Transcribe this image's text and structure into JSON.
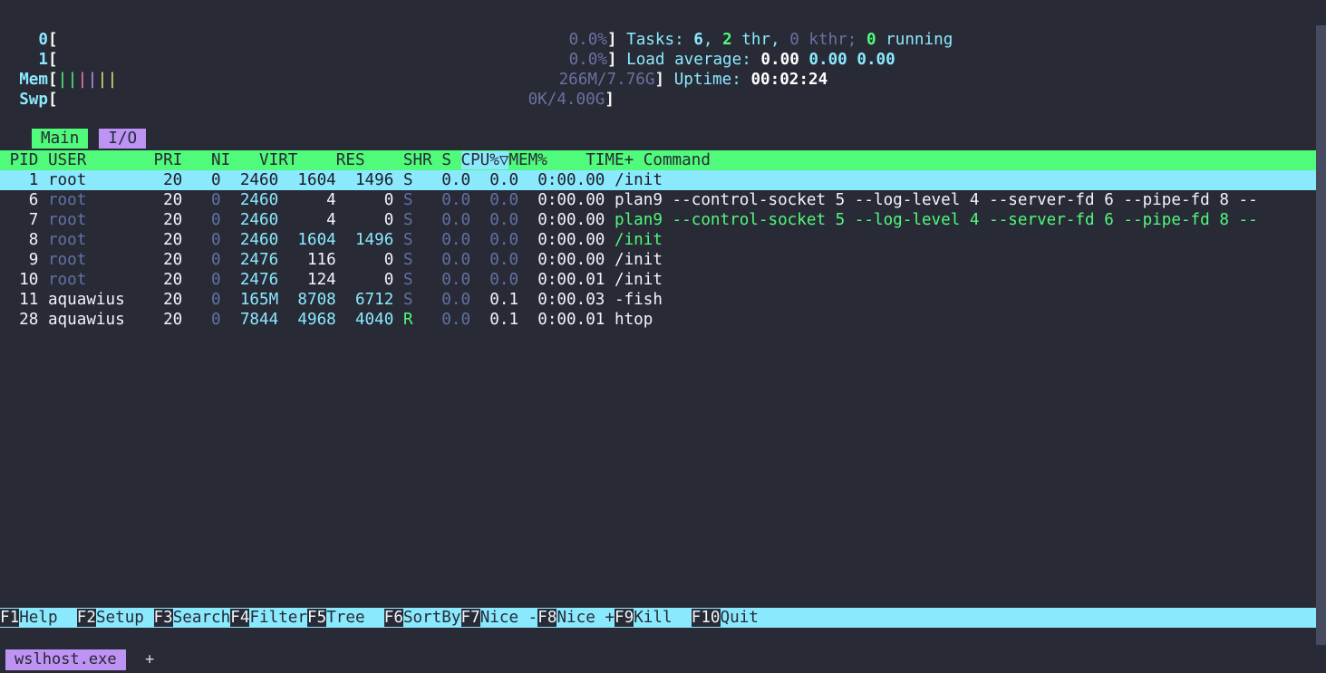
{
  "terminal": {
    "background": "#282a36",
    "foreground": "#f2f4f8"
  },
  "meters": {
    "cpu": [
      {
        "label": "0",
        "bar": "",
        "value": "0.0%"
      },
      {
        "label": "1",
        "bar": "",
        "value": "0.0%"
      }
    ],
    "mem": {
      "label": "Mem",
      "bar_ticks": [
        "|",
        "|",
        "|",
        "|",
        "|",
        "|"
      ],
      "tick_colors": [
        "#50fa7b",
        "#50fa7b",
        "#ff79c6",
        "#bd93f4",
        "#e6e76a",
        "#e6e76a"
      ],
      "value": "266M/7.76G"
    },
    "swp": {
      "label": "Swp",
      "bar_ticks": [],
      "value": "0K/4.00G"
    },
    "bracket_open": "[",
    "bracket_close": "]"
  },
  "summary": {
    "tasks_label": "Tasks:",
    "tasks_count": "6",
    "tasks_comma": ",",
    "threads_count": "2",
    "threads_label": "thr",
    "threads_comma": ",",
    "kthreads": "0 kthr;",
    "running_count": "0",
    "running_label": "running",
    "load_label": "Load average:",
    "load1": "0.00",
    "load5": "0.00",
    "load15": "0.00",
    "uptime_label": "Uptime:",
    "uptime_value": "00:02:24"
  },
  "tabs": [
    {
      "label": "Main",
      "active": true,
      "bg": "#50fa7b"
    },
    {
      "label": "I/O",
      "active": false,
      "bg": "#bd93f4"
    }
  ],
  "table": {
    "columns": [
      "PID",
      "USER",
      "PRI",
      "NI",
      "VIRT",
      "RES",
      "SHR",
      "S",
      "CPU%",
      "MEM%",
      "TIME+",
      "Command"
    ],
    "sort_column": "CPU%",
    "sort_indicator": "▽",
    "header_bg": "#50fa7b",
    "sort_bg": "#8be9fd",
    "rows": [
      {
        "pid": "1",
        "user": "root",
        "pri": "20",
        "ni": "0",
        "virt": "2460",
        "res": "1604",
        "shr": "1496",
        "s": "S",
        "cpu": "0.0",
        "mem": "0.0",
        "time": "0:00.00",
        "command": "/init",
        "selected": true
      },
      {
        "pid": "6",
        "user": "root",
        "pri": "20",
        "ni": "0",
        "virt": "2460",
        "res": "4",
        "shr": "0",
        "s": "S",
        "cpu": "0.0",
        "mem": "0.0",
        "time": "0:00.00",
        "command": "plan9 --control-socket 5 --log-level 4 --server-fd 6 --pipe-fd 8 --",
        "command_color": "white",
        "selected": false
      },
      {
        "pid": "7",
        "user": "root",
        "pri": "20",
        "ni": "0",
        "virt": "2460",
        "res": "4",
        "shr": "0",
        "s": "S",
        "cpu": "0.0",
        "mem": "0.0",
        "time": "0:00.00",
        "command": "plan9 --control-socket 5 --log-level 4 --server-fd 6 --pipe-fd 8 --",
        "command_color": "green",
        "selected": false
      },
      {
        "pid": "8",
        "user": "root",
        "pri": "20",
        "ni": "0",
        "virt": "2460",
        "res": "1604",
        "shr": "1496",
        "s": "S",
        "cpu": "0.0",
        "mem": "0.0",
        "time": "0:00.00",
        "command": "/init",
        "command_color": "green",
        "selected": false
      },
      {
        "pid": "9",
        "user": "root",
        "pri": "20",
        "ni": "0",
        "virt": "2476",
        "res": "116",
        "shr": "0",
        "s": "S",
        "cpu": "0.0",
        "mem": "0.0",
        "time": "0:00.00",
        "command": "/init",
        "command_color": "white",
        "selected": false
      },
      {
        "pid": "10",
        "user": "root",
        "pri": "20",
        "ni": "0",
        "virt": "2476",
        "res": "124",
        "shr": "0",
        "s": "S",
        "cpu": "0.0",
        "mem": "0.0",
        "time": "0:00.01",
        "command": "/init",
        "command_color": "white",
        "selected": false
      },
      {
        "pid": "11",
        "user": "aquawius",
        "pri": "20",
        "ni": "0",
        "virt": "165M",
        "res": "8708",
        "shr": "6712",
        "s": "S",
        "cpu": "0.0",
        "mem": "0.1",
        "time": "0:00.03",
        "command": "-fish",
        "command_color": "white",
        "selected": false
      },
      {
        "pid": "28",
        "user": "aquawius",
        "pri": "20",
        "ni": "0",
        "virt": "7844",
        "res": "4968",
        "shr": "4040",
        "s": "R",
        "cpu": "0.0",
        "mem": "0.1",
        "time": "0:00.01",
        "command": "htop",
        "command_color": "white",
        "selected": false
      }
    ]
  },
  "function_bar": [
    {
      "key": "F1",
      "label": "Help  "
    },
    {
      "key": "F2",
      "label": "Setup "
    },
    {
      "key": "F3",
      "label": "Search"
    },
    {
      "key": "F4",
      "label": "Filter"
    },
    {
      "key": "F5",
      "label": "Tree  "
    },
    {
      "key": "F6",
      "label": "SortBy"
    },
    {
      "key": "F7",
      "label": "Nice -"
    },
    {
      "key": "F8",
      "label": "Nice +"
    },
    {
      "key": "F9",
      "label": "Kill  "
    },
    {
      "key": "F10",
      "label": "Quit  "
    }
  ],
  "taskbar": {
    "tab_label": "wslhost.exe",
    "new_tab_label": "+"
  }
}
